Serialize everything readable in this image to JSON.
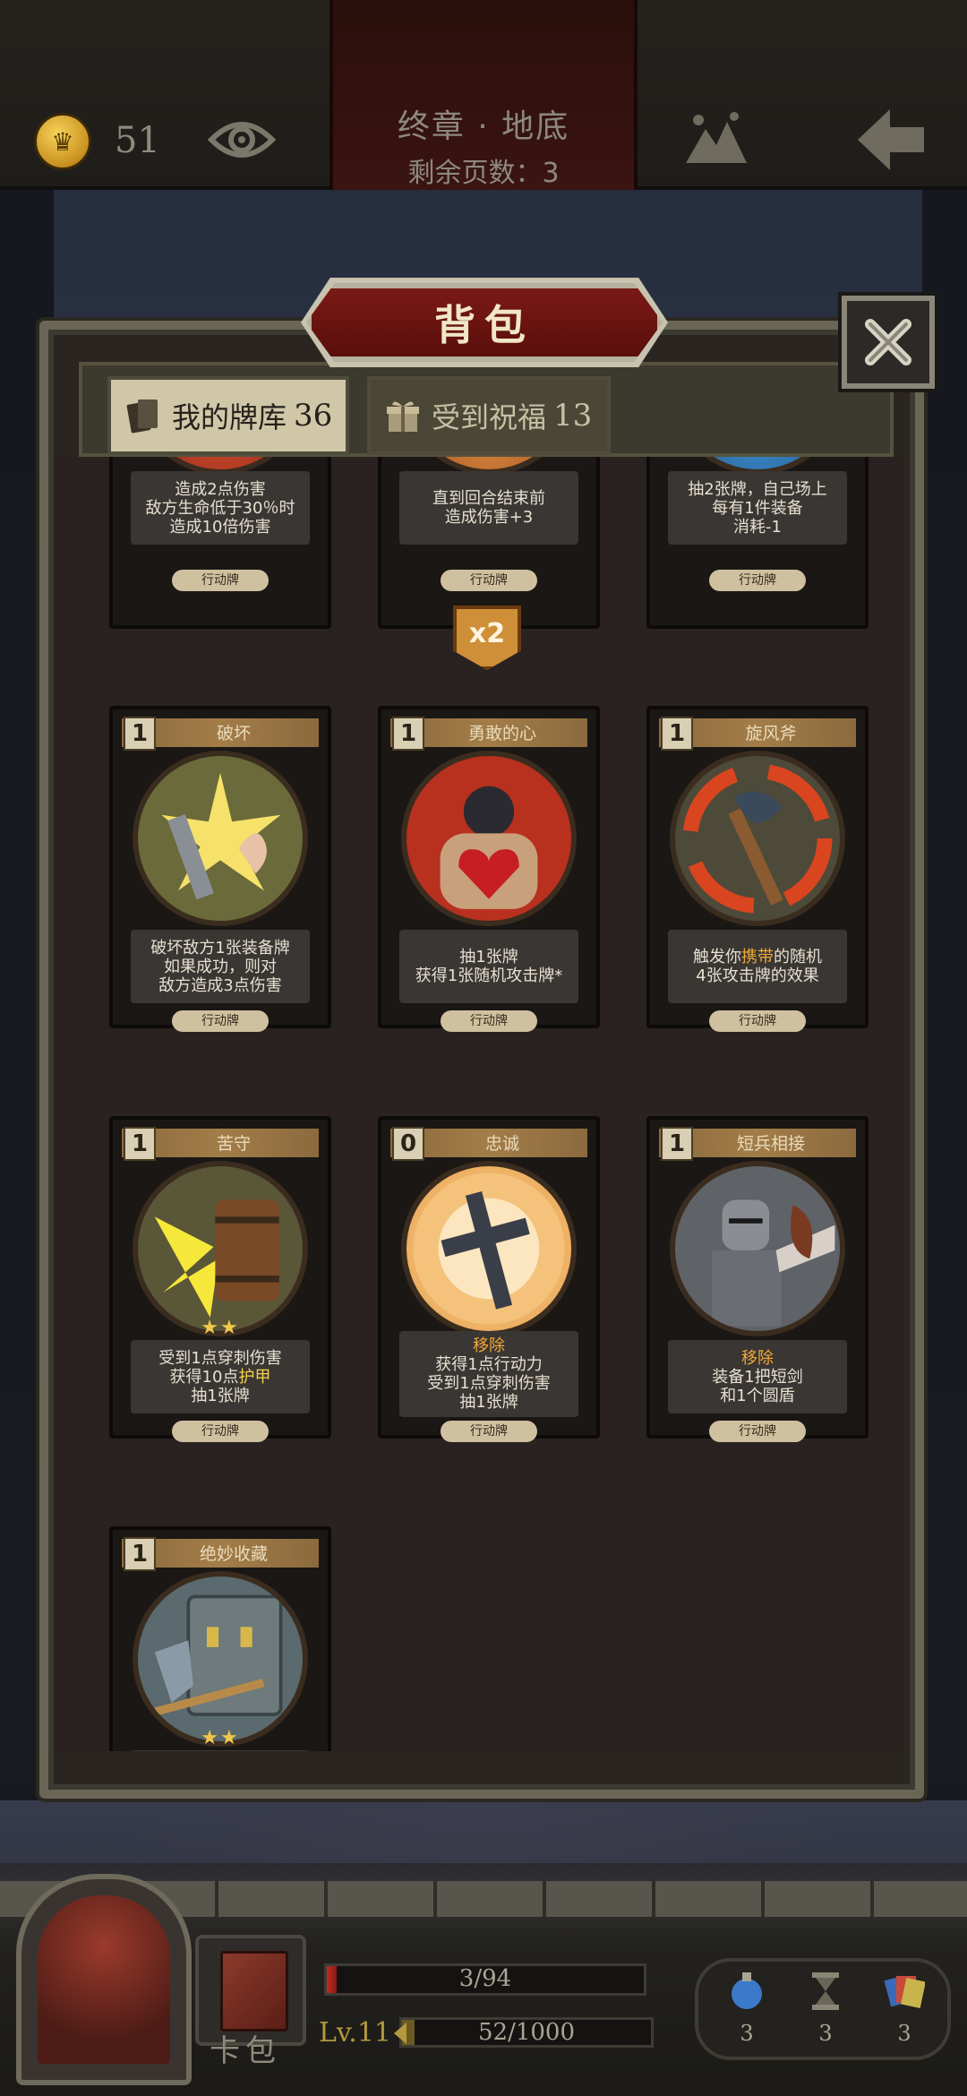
{
  "topbar": {
    "coins": "51",
    "chapter_title": "终章 · 地底",
    "pages_left": "剩余页数：3"
  },
  "panel": {
    "title": "背包",
    "tabs": [
      {
        "label": "我的牌库",
        "count": "36",
        "active": true
      },
      {
        "label": "受到祝福",
        "count": "13",
        "active": false
      }
    ]
  },
  "cards_row0": [
    {
      "desc": [
        "造成2点伤害",
        "敌方生命低于30％时",
        "造成10倍伤害"
      ],
      "type": "行动牌"
    },
    {
      "desc": [
        "直到回合结束前",
        "造成伤害+3"
      ],
      "type": "行动牌",
      "badge": "x2"
    },
    {
      "desc": [
        "抽2张牌，自己场上",
        "每有1件装备",
        "消耗-1"
      ],
      "type": "行动牌"
    }
  ],
  "cards_row1": [
    {
      "cost": "1",
      "name": "破坏",
      "desc": [
        "破坏敌方1张装备牌",
        "如果成功，则对",
        "敌方造成3点伤害"
      ],
      "type": "行动牌"
    },
    {
      "cost": "1",
      "name": "勇敢的心",
      "desc": [
        "抽1张牌",
        "获得1张随机攻击牌*"
      ],
      "type": "行动牌"
    },
    {
      "cost": "1",
      "name": "旋风斧",
      "desc_pre": "触发你",
      "desc_hl": "携带",
      "desc_post": "的随机",
      "desc2": "4张攻击牌的效果",
      "type": "行动牌"
    }
  ],
  "cards_row2": [
    {
      "cost": "1",
      "name": "苦守",
      "stars": "★★",
      "desc1": "受到1点穿刺伤害",
      "desc2_pre": "获得10点",
      "desc2_hl": "护甲",
      "desc3": "抽1张牌",
      "type": "行动牌"
    },
    {
      "cost": "0",
      "name": "忠诚",
      "hl": "移除",
      "desc": [
        "获得1点行动力",
        "受到1点穿刺伤害",
        "抽1张牌"
      ],
      "type": "行动牌"
    },
    {
      "cost": "1",
      "name": "短兵相接",
      "hl": "移除",
      "desc": [
        "装备1把短剑",
        "和1个圆盾"
      ],
      "type": "行动牌"
    }
  ],
  "cards_row3": [
    {
      "cost": "1",
      "name": "绝妙收藏",
      "stars": "★★"
    }
  ],
  "bottombar": {
    "cardpack_label": "卡包",
    "hp_text": "3/94",
    "hp_fraction": 0.032,
    "level": "Lv.11",
    "xp_text": "52/1000",
    "xp_fraction": 0.052,
    "inventory": [
      {
        "icon": "potion-icon",
        "count": "3"
      },
      {
        "icon": "hourglass-icon",
        "count": "3"
      },
      {
        "icon": "cards-icon",
        "count": "3"
      }
    ]
  },
  "colors": {
    "accent_red": "#7a1a16",
    "highlight_orange": "#f0a93a",
    "highlight_yellow": "#f7d14c",
    "star": "#f2c84a"
  }
}
